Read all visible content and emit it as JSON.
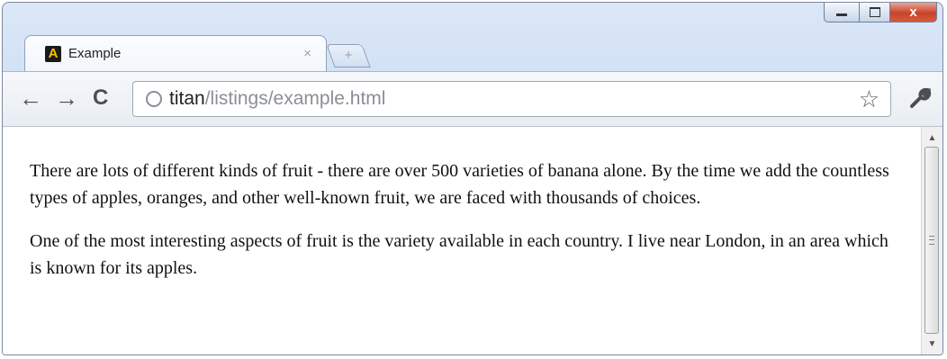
{
  "window": {
    "controls": {
      "minimize": "",
      "maximize": "",
      "close": "x"
    }
  },
  "tab": {
    "favicon_letter": "A",
    "title": "Example",
    "close_label": "×"
  },
  "newtab": {
    "label": "+"
  },
  "toolbar": {
    "back_icon": "←",
    "forward_icon": "→",
    "reload_icon": "C",
    "url_host": "titan",
    "url_path": "/listings/example.html",
    "star_icon": "☆",
    "wrench_icon": "🔧"
  },
  "page": {
    "paragraphs": [
      "There are lots of different kinds of fruit - there are over 500 varieties of banana alone. By the time we add the countless types of apples, oranges, and other well-known fruit, we are faced with thousands of choices.",
      "One of the most interesting aspects of fruit is the variety available in each country. I live near London, in an area which is known for its apples."
    ]
  },
  "scrollbar": {
    "up_icon": "▲",
    "down_icon": "▼"
  }
}
